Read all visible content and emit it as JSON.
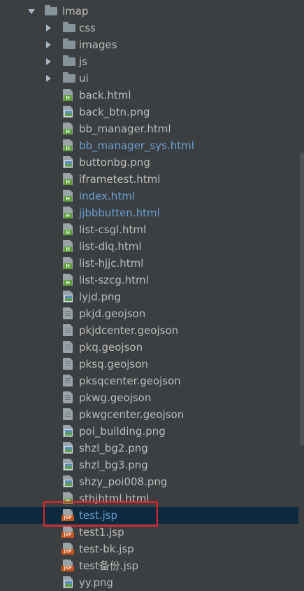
{
  "root": {
    "name": "lmap",
    "expanded": true
  },
  "folders": [
    {
      "name": "css"
    },
    {
      "name": "images"
    },
    {
      "name": "js"
    },
    {
      "name": "ui"
    }
  ],
  "files": [
    {
      "name": "back.html",
      "type": "html",
      "color": "normal"
    },
    {
      "name": "back_btn.png",
      "type": "png",
      "color": "normal"
    },
    {
      "name": "bb_manager.html",
      "type": "html",
      "color": "normal"
    },
    {
      "name": "bb_manager_sys.html",
      "type": "html",
      "color": "blue"
    },
    {
      "name": "buttonbg.png",
      "type": "png",
      "color": "normal"
    },
    {
      "name": "iframetest.html",
      "type": "html",
      "color": "normal"
    },
    {
      "name": "index.html",
      "type": "html",
      "color": "blue"
    },
    {
      "name": "jjbbbutten.html",
      "type": "html",
      "color": "blue"
    },
    {
      "name": "list-csgl.html",
      "type": "html",
      "color": "normal"
    },
    {
      "name": "list-dlq.html",
      "type": "html",
      "color": "normal"
    },
    {
      "name": "list-hjjc.html",
      "type": "html",
      "color": "normal"
    },
    {
      "name": "list-szcg.html",
      "type": "html",
      "color": "normal"
    },
    {
      "name": "lyjd.png",
      "type": "png",
      "color": "normal"
    },
    {
      "name": "pkjd.geojson",
      "type": "geojson",
      "color": "normal"
    },
    {
      "name": "pkjdcenter.geojson",
      "type": "geojson",
      "color": "normal"
    },
    {
      "name": "pkq.geojson",
      "type": "geojson",
      "color": "normal"
    },
    {
      "name": "pksq.geojson",
      "type": "geojson",
      "color": "normal"
    },
    {
      "name": "pksqcenter.geojson",
      "type": "geojson",
      "color": "normal"
    },
    {
      "name": "pkwg.geojson",
      "type": "geojson",
      "color": "normal"
    },
    {
      "name": "pkwgcenter.geojson",
      "type": "geojson",
      "color": "normal"
    },
    {
      "name": "poi_building.png",
      "type": "png",
      "color": "normal"
    },
    {
      "name": "shzl_bg2.png",
      "type": "png",
      "color": "normal"
    },
    {
      "name": "shzl_bg3.png",
      "type": "png",
      "color": "normal"
    },
    {
      "name": "shzy_poi008.png",
      "type": "png",
      "color": "normal"
    },
    {
      "name": "sthjhtml.html",
      "type": "html",
      "color": "normal"
    },
    {
      "name": "test.jsp",
      "type": "jsp",
      "color": "blue",
      "selected": true
    },
    {
      "name": "test1.jsp",
      "type": "jsp",
      "color": "normal"
    },
    {
      "name": "test-bk.jsp",
      "type": "jsp",
      "color": "normal"
    },
    {
      "name": "test备份.jsp",
      "type": "jsp",
      "color": "normal"
    },
    {
      "name": "yy.png",
      "type": "png",
      "color": "normal"
    }
  ],
  "colors": {
    "background": "#3c3f41",
    "text": "#bbbbbb",
    "modified_text": "#6a9fd4",
    "selection": "#0d293e",
    "highlight_box": "#e1252b"
  }
}
